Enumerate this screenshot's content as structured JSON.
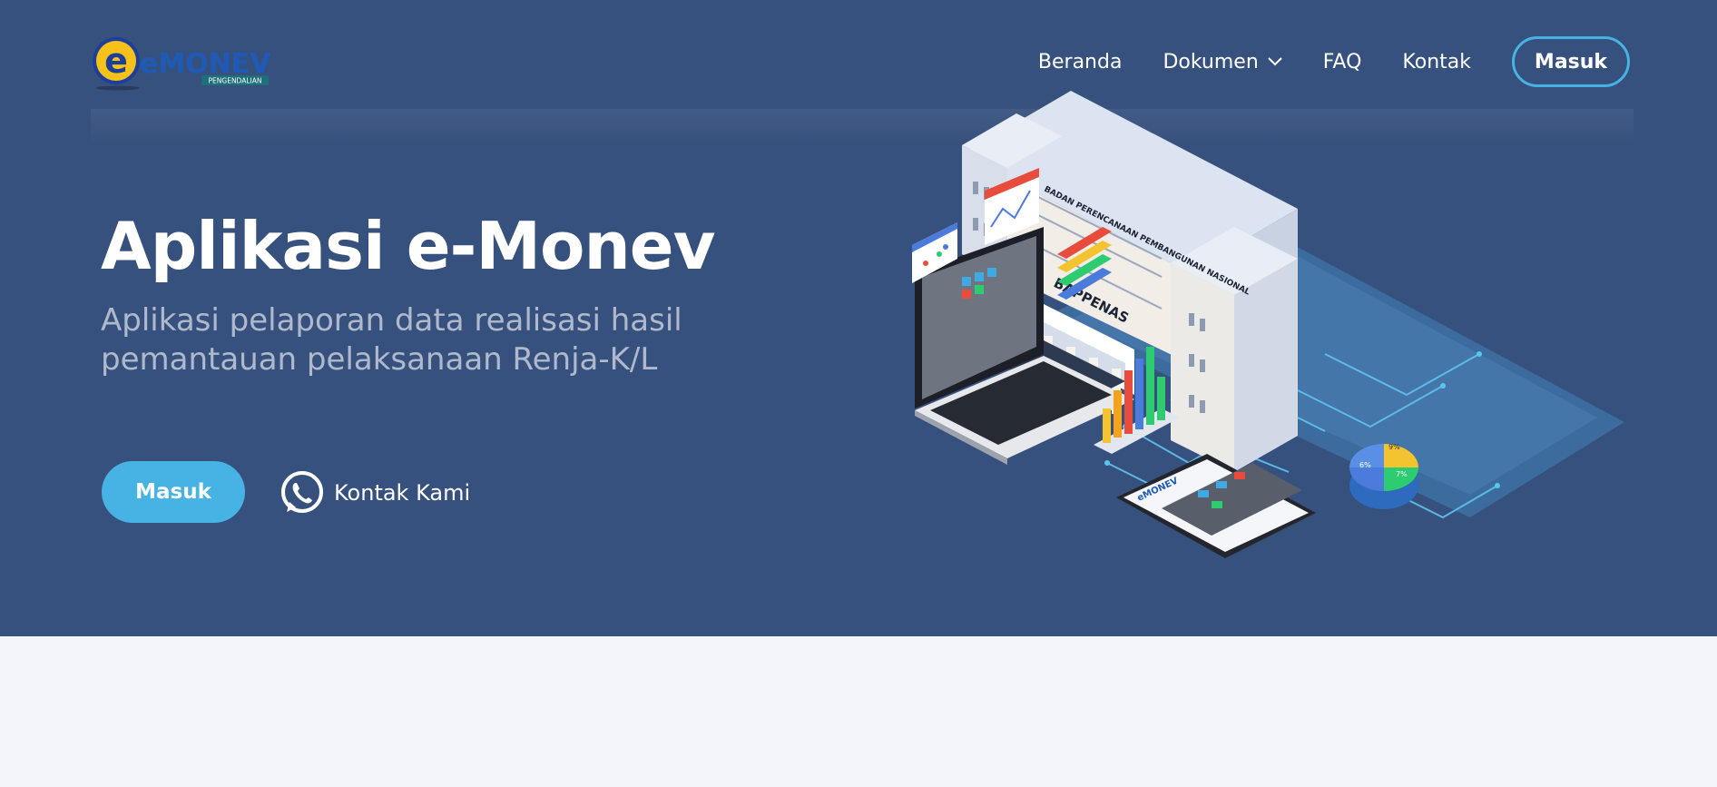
{
  "header": {
    "logo_text": "eMONEV",
    "logo_subtext": "PENGENDALIAN",
    "nav": [
      {
        "label": "Beranda"
      },
      {
        "label": "Dokumen",
        "has_dropdown": true
      },
      {
        "label": "FAQ"
      },
      {
        "label": "Kontak"
      }
    ],
    "login_button": "Masuk"
  },
  "hero": {
    "title": "Aplikasi e-Monev",
    "subtitle": "Aplikasi pelaporan data realisasi hasil pemantauan pelaksanaan Renja-K/L",
    "cta_button": "Masuk",
    "contact_link": "Kontak Kami",
    "contact_icon": "whatsapp-icon",
    "illustration": {
      "building_sign_top": "BADAN PERENCANAAN PEMBANGUNAN NASIONAL",
      "building_sign": "BAPPENAS",
      "pie_labels": [
        "9%",
        "6%",
        "7%"
      ],
      "phone_logo": "eMONEV"
    }
  },
  "colors": {
    "hero_bg": "#37517e",
    "accent": "#47b2e4",
    "page_bg": "#f3f5fa"
  }
}
